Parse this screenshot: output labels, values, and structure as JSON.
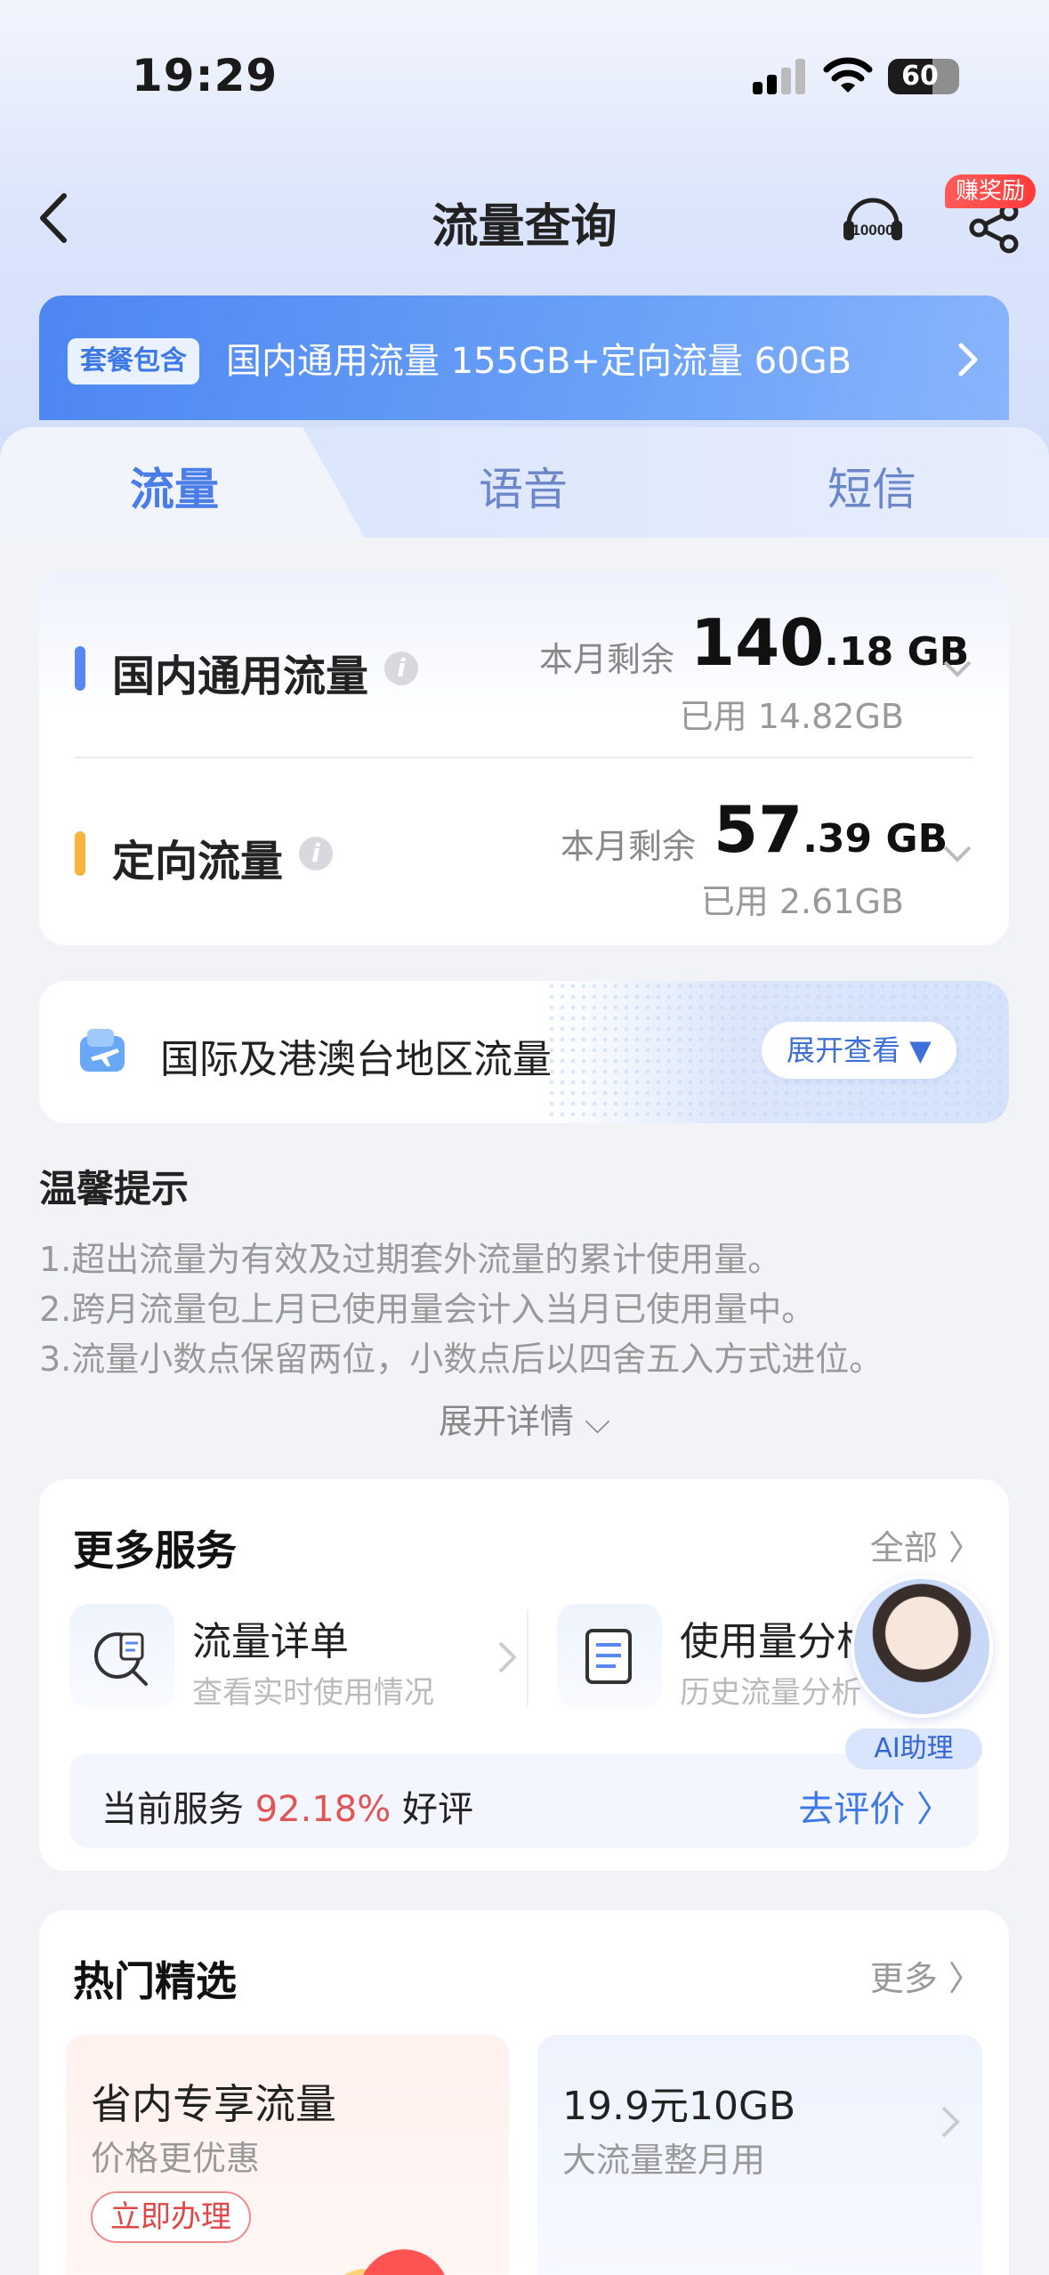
{
  "status_bar": {
    "time": "19:29",
    "battery": "60"
  },
  "nav": {
    "title": "流量查询",
    "service_number": "10000",
    "reward_badge": "赚奖励"
  },
  "package": {
    "tag": "套餐包含",
    "text": "国内通用流量 155GB+定向流量 60GB"
  },
  "tabs": [
    {
      "label": "流量",
      "active": true
    },
    {
      "label": "语音",
      "active": false
    },
    {
      "label": "短信",
      "active": false
    }
  ],
  "flows": [
    {
      "name": "国内通用流量",
      "remain_label": "本月剩余",
      "remain_int": "140",
      "remain_dec": ".18",
      "unit": "GB",
      "used": "已用 14.82GB",
      "color": "#5a86f0"
    },
    {
      "name": "定向流量",
      "remain_label": "本月剩余",
      "remain_int": "57",
      "remain_dec": ".39",
      "unit": "GB",
      "used": "已用 2.61GB",
      "color": "#f7b540"
    }
  ],
  "intl": {
    "label": "国际及港澳台地区流量",
    "button": "展开查看 ▼"
  },
  "tips": {
    "title": "温馨提示",
    "lines": [
      "1.超出流量为有效及过期套外流量的累计使用量。",
      "2.跨月流量包上月已使用量会计入当月已使用量中。",
      "3.流量小数点保留两位，小数点后以四舍五入方式进位。"
    ],
    "expand": "展开详情 ⌵"
  },
  "more_services": {
    "title": "更多服务",
    "all": "全部 〉",
    "items": [
      {
        "title": "流量详单",
        "subtitle": "查看实时使用情况"
      },
      {
        "title": "使用量分析",
        "subtitle": "历史流量分析"
      }
    ],
    "rating_prefix": "当前服务",
    "rating_pct": "92.18%",
    "rating_suffix": "好评",
    "rating_action": "去评价 〉"
  },
  "ai_assistant": {
    "label": "AI助理"
  },
  "hot": {
    "title": "热门精选",
    "more": "更多 〉",
    "items": [
      {
        "title": "省内专享流量",
        "subtitle": "价格更优惠",
        "button": "立即办理"
      },
      {
        "title": "19.9元10GB",
        "subtitle": "大流量整月用"
      }
    ]
  },
  "colors": {
    "accent": "#4a7de8",
    "danger": "#e05555",
    "orange": "#f7b540"
  }
}
